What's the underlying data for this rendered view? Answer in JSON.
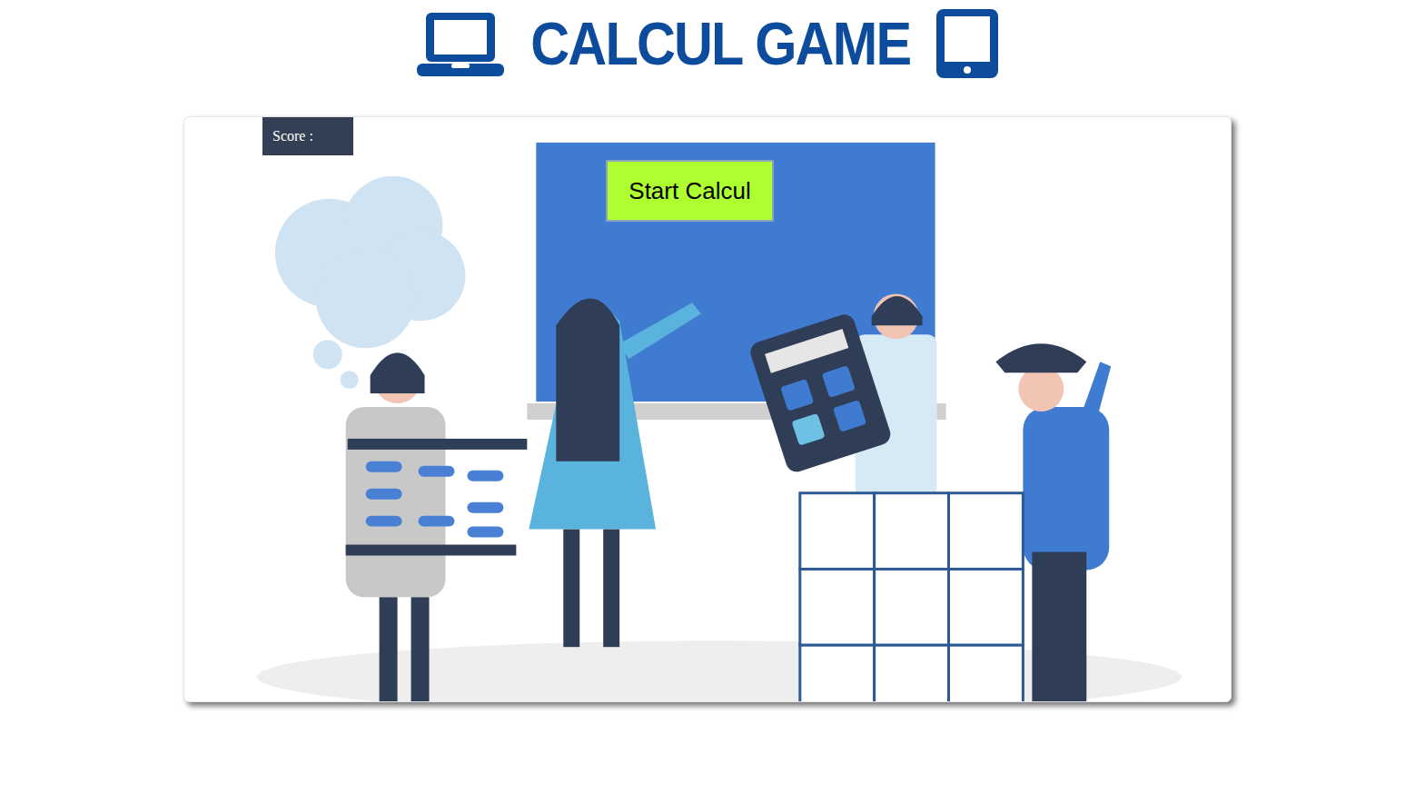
{
  "header": {
    "title": "CALCUL GAME"
  },
  "score": {
    "label": "Score :"
  },
  "start_button": {
    "label": "Start Calcul"
  }
}
